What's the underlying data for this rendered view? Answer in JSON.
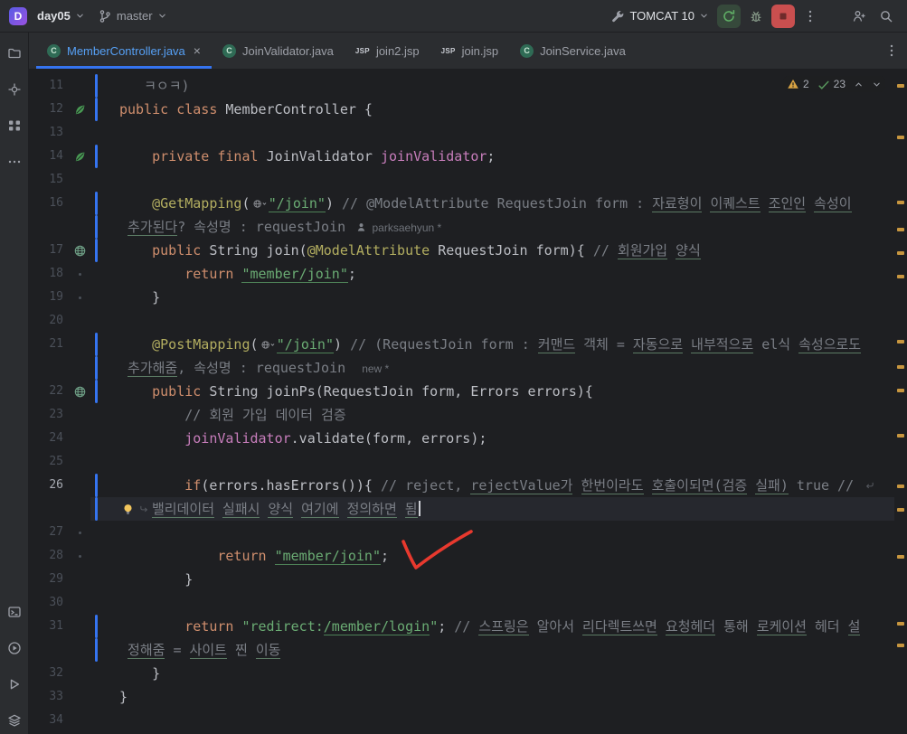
{
  "colors": {
    "accent_blue": "#3574F0",
    "modified_file_blue": "#56A0F5",
    "warning_yellow": "#D9A343",
    "typo_green": "#57965C",
    "stop_red": "#C94F4F",
    "run_green": "#5FAD65",
    "keyword_orange": "#CF8E6D",
    "string_green": "#6AAB73",
    "comment_gray": "#7A7E85",
    "annotation_yellow": "#B3AE60",
    "field_purple": "#C77DBB",
    "annotation_arrow_red": "#E8392E"
  },
  "icons": {
    "java_class_letter": "C",
    "jsp_label": "JSP",
    "close_glyph": "×"
  },
  "titlebar": {
    "project_badge": "D",
    "project_name": "day05",
    "branch_name": "master",
    "run_config_name": "TOMCAT 10",
    "right_icons": [
      "run-config",
      "rerun",
      "debug",
      "stop",
      "more-vertical",
      "add-user",
      "search"
    ]
  },
  "sidebar": {
    "top_icons": [
      "project-folder",
      "commit",
      "structure",
      "more-horizontal"
    ],
    "bottom_icons": [
      "terminal",
      "run",
      "services",
      "build-layers"
    ]
  },
  "tabbar": {
    "tabs": [
      {
        "label": "MemberController.java",
        "icon": "java-class",
        "active": true,
        "modified": true,
        "closable": true
      },
      {
        "label": "JoinValidator.java",
        "icon": "java-class"
      },
      {
        "label": "join2.jsp",
        "icon": "jsp"
      },
      {
        "label": "join.jsp",
        "icon": "jsp"
      },
      {
        "label": "JoinService.java",
        "icon": "java-class"
      }
    ]
  },
  "inspections": {
    "warnings": "2",
    "typos": "23"
  },
  "editor": {
    "stripe_marks": [
      16,
      73,
      145,
      175,
      201,
      227,
      299,
      327,
      353,
      403,
      459,
      485,
      537,
      611,
      635
    ],
    "rows": [
      {
        "num": "11",
        "changed": true,
        "seg": [
          {
            "t": "   ㅋㅇㅋ)",
            "c": "c"
          }
        ]
      },
      {
        "num": "12",
        "gutter": "spring-bean",
        "changed": true,
        "seg": [
          {
            "t": "public class ",
            "c": "k"
          },
          {
            "t": "MemberController {",
            "c": "p"
          }
        ]
      },
      {
        "num": "13",
        "seg": []
      },
      {
        "num": "14",
        "gutter": "spring-bean",
        "changed": true,
        "seg": [
          {
            "t": "    ",
            "c": "p"
          },
          {
            "t": "private final ",
            "c": "k"
          },
          {
            "t": "JoinValidator ",
            "c": "p"
          },
          {
            "t": "joinValidator",
            "c": "f"
          },
          {
            "t": ";",
            "c": "p"
          }
        ]
      },
      {
        "num": "15",
        "seg": []
      },
      {
        "num": "16",
        "changed": true,
        "seg": [
          {
            "t": "    ",
            "c": "p"
          },
          {
            "t": "@GetMapping",
            "c": "a"
          },
          {
            "t": "(",
            "c": "p"
          },
          {
            "icon": "url-inlay"
          },
          {
            "t": "\"/join\"",
            "c": "su"
          },
          {
            "t": ") ",
            "c": "p"
          },
          {
            "t": "// @ModelAttribute RequestJoin form : ",
            "c": "c"
          },
          {
            "t": "자료형이",
            "c": "cu"
          },
          {
            "t": " ",
            "c": "c"
          },
          {
            "t": "이퀘스트",
            "c": "cu"
          },
          {
            "t": " ",
            "c": "c"
          },
          {
            "t": "조인인",
            "c": "cu"
          },
          {
            "t": " ",
            "c": "c"
          },
          {
            "t": "속성이",
            "c": "cu"
          }
        ]
      },
      {
        "num": "",
        "changed": true,
        "seg": [
          {
            "t": " ",
            "c": "c"
          },
          {
            "t": "추가된다",
            "c": "cu"
          },
          {
            "t": "? 속성명 : requestJoin ",
            "c": "c"
          },
          {
            "icon": "blame-person"
          },
          {
            "t": " parksaehyun *",
            "c": "i"
          }
        ]
      },
      {
        "num": "17",
        "gutter": "request-mapping",
        "changed": true,
        "seg": [
          {
            "t": "    ",
            "c": "p"
          },
          {
            "t": "public ",
            "c": "k"
          },
          {
            "t": "String join(",
            "c": "p"
          },
          {
            "t": "@ModelAttribute ",
            "c": "a"
          },
          {
            "t": "RequestJoin form){ ",
            "c": "p"
          },
          {
            "t": "// ",
            "c": "c"
          },
          {
            "t": "회원가입",
            "c": "cu"
          },
          {
            "t": " ",
            "c": "c"
          },
          {
            "t": "양식",
            "c": "cu"
          }
        ]
      },
      {
        "num": "18",
        "dot": true,
        "seg": [
          {
            "t": "        ",
            "c": "p"
          },
          {
            "t": "return ",
            "c": "k"
          },
          {
            "t": "\"member/join\"",
            "c": "su"
          },
          {
            "t": ";",
            "c": "p"
          }
        ]
      },
      {
        "num": "19",
        "dot": true,
        "seg": [
          {
            "t": "    }",
            "c": "p"
          }
        ]
      },
      {
        "num": "20",
        "seg": []
      },
      {
        "num": "21",
        "changed": true,
        "seg": [
          {
            "t": "    ",
            "c": "p"
          },
          {
            "t": "@PostMapping",
            "c": "a"
          },
          {
            "t": "(",
            "c": "p"
          },
          {
            "icon": "url-inlay"
          },
          {
            "t": "\"/join\"",
            "c": "su"
          },
          {
            "t": ") ",
            "c": "p"
          },
          {
            "t": "// (RequestJoin form : ",
            "c": "c"
          },
          {
            "t": "커맨드",
            "c": "cu"
          },
          {
            "t": " 객체 = ",
            "c": "c"
          },
          {
            "t": "자동으로",
            "c": "cu"
          },
          {
            "t": " ",
            "c": "c"
          },
          {
            "t": "내부적으로",
            "c": "cu"
          },
          {
            "t": " el식 ",
            "c": "c"
          },
          {
            "t": "속성으로도",
            "c": "cu"
          }
        ]
      },
      {
        "num": "",
        "changed": true,
        "seg": [
          {
            "t": " ",
            "c": "c"
          },
          {
            "t": "추가해줌",
            "c": "cu"
          },
          {
            "t": ", 속성명 : requestJoin  ",
            "c": "c"
          },
          {
            "t": "new *",
            "c": "i"
          }
        ]
      },
      {
        "num": "22",
        "gutter": "request-mapping",
        "changed": true,
        "seg": [
          {
            "t": "    ",
            "c": "p"
          },
          {
            "t": "public ",
            "c": "k"
          },
          {
            "t": "String joinPs(RequestJoin form, Errors errors){",
            "c": "p"
          }
        ]
      },
      {
        "num": "23",
        "seg": [
          {
            "t": "        ",
            "c": "p"
          },
          {
            "t": "// 회원 가입 데이터 검증",
            "c": "c"
          }
        ]
      },
      {
        "num": "24",
        "seg": [
          {
            "t": "        ",
            "c": "p"
          },
          {
            "t": "joinValidator",
            "c": "f"
          },
          {
            "t": ".validate(form, errors);",
            "c": "p"
          }
        ]
      },
      {
        "num": "25",
        "seg": []
      },
      {
        "num": "26",
        "numhl": true,
        "changed": true,
        "seg": [
          {
            "t": "        ",
            "c": "p"
          },
          {
            "t": "if",
            "c": "k"
          },
          {
            "t": "(errors.hasErrors()){ ",
            "c": "p"
          },
          {
            "t": "// reject, ",
            "c": "c"
          },
          {
            "t": "rejectValue가",
            "c": "cu"
          },
          {
            "t": " ",
            "c": "c"
          },
          {
            "t": "한번이라도",
            "c": "cu"
          },
          {
            "t": " ",
            "c": "c"
          },
          {
            "t": "호출이되면(검증",
            "c": "cu"
          },
          {
            "t": " ",
            "c": "c"
          },
          {
            "t": "실패)",
            "c": "cu"
          },
          {
            "t": " true // ",
            "c": "c"
          },
          {
            "icon": "soft-wrap-end"
          }
        ]
      },
      {
        "num": "",
        "caret": true,
        "changed": true,
        "seg": [
          {
            "icon": "intention-bulb"
          },
          {
            "icon": "soft-wrap-start"
          },
          {
            "t": "밸리데이터",
            "c": "cu"
          },
          {
            "t": " ",
            "c": "c"
          },
          {
            "t": "실패시",
            "c": "cu"
          },
          {
            "t": " ",
            "c": "c"
          },
          {
            "t": "양식",
            "c": "cu"
          },
          {
            "t": " ",
            "c": "c"
          },
          {
            "t": "여기에",
            "c": "cu"
          },
          {
            "t": " ",
            "c": "c"
          },
          {
            "t": "정의하면",
            "c": "cu"
          },
          {
            "t": " ",
            "c": "c"
          },
          {
            "t": "됨",
            "c": "cu"
          },
          {
            "icon": "caret"
          }
        ]
      },
      {
        "num": "27",
        "dot": true,
        "seg": []
      },
      {
        "num": "28",
        "dot": true,
        "seg": [
          {
            "t": "            ",
            "c": "p"
          },
          {
            "t": "return ",
            "c": "k"
          },
          {
            "t": "\"member/join\"",
            "c": "su"
          },
          {
            "t": ";",
            "c": "p"
          }
        ]
      },
      {
        "num": "29",
        "seg": [
          {
            "t": "        }",
            "c": "p"
          }
        ]
      },
      {
        "num": "30",
        "seg": []
      },
      {
        "num": "31",
        "changed": true,
        "seg": [
          {
            "t": "        ",
            "c": "p"
          },
          {
            "t": "return ",
            "c": "k"
          },
          {
            "t": "\"redirect:",
            "c": "s"
          },
          {
            "t": "/member/login",
            "c": "su"
          },
          {
            "t": "\"",
            "c": "s"
          },
          {
            "t": "; ",
            "c": "p"
          },
          {
            "t": "// ",
            "c": "c"
          },
          {
            "t": "스프링은",
            "c": "cu"
          },
          {
            "t": " 알아서 ",
            "c": "c"
          },
          {
            "t": "리다렉트쓰면",
            "c": "cu"
          },
          {
            "t": " ",
            "c": "c"
          },
          {
            "t": "요청헤더",
            "c": "cu"
          },
          {
            "t": " 통해 ",
            "c": "c"
          },
          {
            "t": "로케이션",
            "c": "cu"
          },
          {
            "t": " 헤더 ",
            "c": "c"
          },
          {
            "t": "설",
            "c": "cu"
          }
        ]
      },
      {
        "num": "",
        "changed": true,
        "seg": [
          {
            "t": " ",
            "c": "c"
          },
          {
            "t": "정해줌",
            "c": "cu"
          },
          {
            "t": " = ",
            "c": "c"
          },
          {
            "t": "사이트",
            "c": "cu"
          },
          {
            "t": " 찐 ",
            "c": "c"
          },
          {
            "t": "이동",
            "c": "cu"
          }
        ]
      },
      {
        "num": "32",
        "seg": [
          {
            "t": "    }",
            "c": "p"
          }
        ]
      },
      {
        "num": "33",
        "seg": [
          {
            "t": "}",
            "c": "p"
          }
        ]
      },
      {
        "num": "34",
        "seg": []
      }
    ]
  }
}
